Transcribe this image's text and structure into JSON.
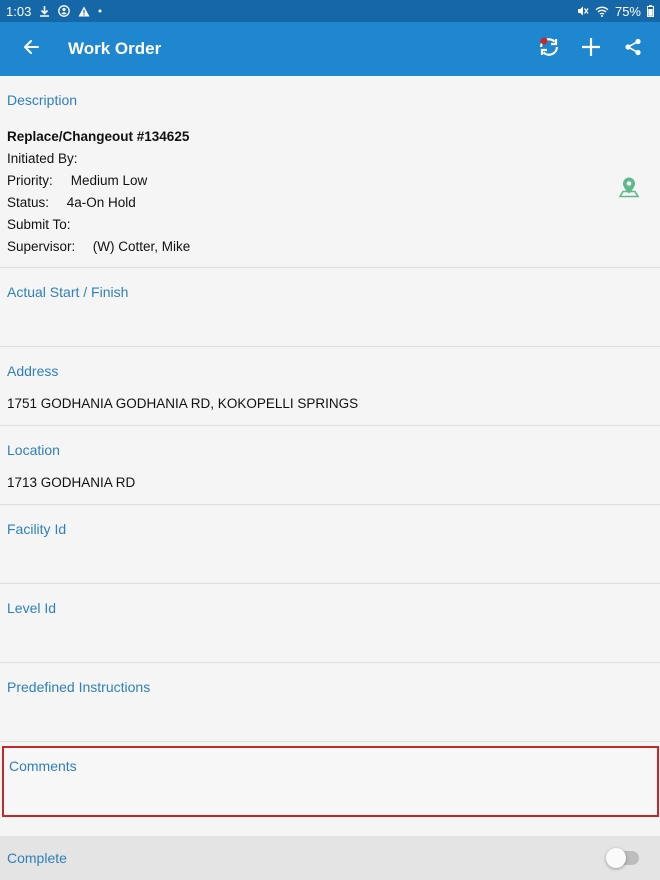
{
  "status_bar": {
    "time": "1:03",
    "battery": "75%",
    "icons": [
      "download-icon",
      "accessibility-icon",
      "warning-icon",
      "dot-icon",
      "mute-icon",
      "wifi-icon",
      "battery-icon"
    ]
  },
  "app_bar": {
    "title": "Work Order",
    "icons": [
      "back-arrow-icon",
      "sync-icon",
      "add-icon",
      "share-icon"
    ],
    "sync_badge_color": "#c62828"
  },
  "description": {
    "label": "Description",
    "title": "Replace/Changeout #134625",
    "initiated_by_label": "Initiated By:",
    "initiated_by_value": "",
    "priority_label": "Priority:",
    "priority_value": "Medium Low",
    "status_label": "Status:",
    "status_value": "4a-On Hold",
    "submit_to_label": "Submit To:",
    "submit_to_value": "",
    "supervisor_label": "Supervisor:",
    "supervisor_value": "(W) Cotter, Mike",
    "map_icon": "map-pin-icon",
    "map_icon_color": "#5fb98b"
  },
  "actual_start_finish": {
    "label": "Actual Start / Finish",
    "value": ""
  },
  "address": {
    "label": "Address",
    "value": "1751 GODHANIA GODHANIA RD, KOKOPELLI SPRINGS"
  },
  "location": {
    "label": "Location",
    "value": "1713 GODHANIA RD"
  },
  "facility_id": {
    "label": "Facility Id",
    "value": ""
  },
  "level_id": {
    "label": "Level Id",
    "value": ""
  },
  "predefined_instructions": {
    "label": "Predefined Instructions",
    "value": ""
  },
  "comments": {
    "label": "Comments",
    "value": "",
    "highlight_color": "#c62828"
  },
  "complete": {
    "label": "Complete",
    "toggle_on": false
  },
  "colors": {
    "status_bar": "#1667a8",
    "app_bar": "#1f86d0",
    "label": "#2f80b8"
  }
}
